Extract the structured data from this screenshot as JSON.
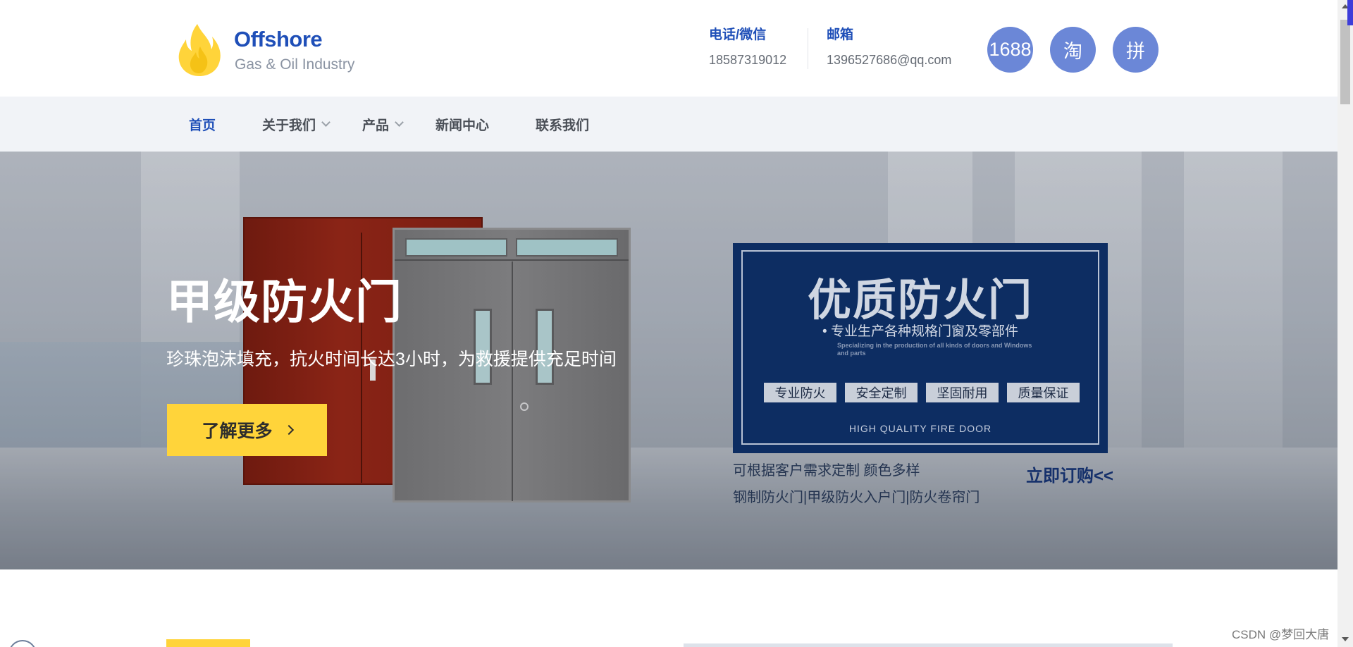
{
  "header": {
    "logo_title": "Offshore",
    "logo_subtitle": "Gas & Oil Industry",
    "phone_label": "电话/微信",
    "phone_value": "18587319012",
    "email_label": "邮箱",
    "email_value": "1396527686@qq.com",
    "badges": [
      "1688",
      "淘",
      "拼"
    ]
  },
  "nav": {
    "items": [
      {
        "label": "首页",
        "active": true
      },
      {
        "label": "关于我们",
        "dropdown": true
      },
      {
        "label": "产品",
        "dropdown": true
      },
      {
        "label": "新闻中心"
      },
      {
        "label": "联系我们"
      }
    ]
  },
  "hero": {
    "title": "甲级防火门",
    "subtitle": "珍珠泡沫填充，抗火时间长达3小时，为救援提供充足时间",
    "button_label": "了解更多"
  },
  "promo": {
    "title": "优质防火门",
    "subtitle": "• 专业生产各种规格门窗及零部件",
    "subtitle_en": "Specializing in the production of all kinds of doors and Windows and parts",
    "tags": [
      "专业防火",
      "安全定制",
      "坚固耐用",
      "质量保证"
    ],
    "footer": "HIGH QUALITY  FIRE DOOR",
    "note": "可根据客户需求定制 颜色多样",
    "links": "钢制防火门|甲级防火入户门|防火卷帘门",
    "buy_label": "立即订购<<"
  },
  "watermark": "CSDN @梦回大唐",
  "colors": {
    "brand_blue": "#1f4fb8",
    "badge_blue": "#6b87d7",
    "accent_yellow": "#ffd43a",
    "nav_bg": "#f1f3f7",
    "promo_navy": "#0d2d62"
  },
  "icons": [
    "flame-logo-icon",
    "chevron-down-icon",
    "chevron-right-icon"
  ]
}
